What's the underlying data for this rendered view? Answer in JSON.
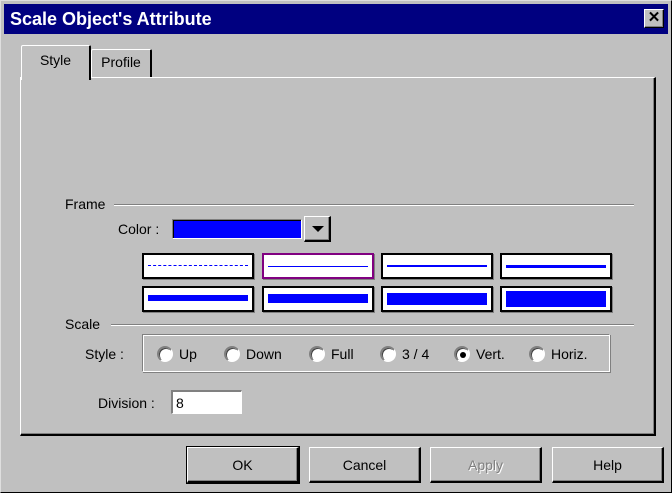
{
  "window": {
    "title": "Scale Object's Attribute",
    "close_label": "✕"
  },
  "tabs": [
    {
      "label": "Style",
      "active": true
    },
    {
      "label": "Profile",
      "active": false
    }
  ],
  "frame": {
    "group_label": "Frame",
    "color_label": "Color :",
    "color_value": "#0000ff",
    "options": [
      {
        "id": 1,
        "selected": false
      },
      {
        "id": 2,
        "selected": true
      },
      {
        "id": 3,
        "selected": false
      },
      {
        "id": 4,
        "selected": false
      },
      {
        "id": 5,
        "selected": false
      },
      {
        "id": 6,
        "selected": false
      },
      {
        "id": 7,
        "selected": false
      },
      {
        "id": 8,
        "selected": false
      }
    ]
  },
  "scale": {
    "group_label": "Scale",
    "style_label": "Style :",
    "style_options": [
      "Up",
      "Down",
      "Full",
      "3 / 4",
      "Vert.",
      "Horiz."
    ],
    "style_selected": "Vert.",
    "division_label": "Division :",
    "division_value": "8"
  },
  "buttons": {
    "ok": "OK",
    "cancel": "Cancel",
    "apply": "Apply",
    "help": "Help"
  },
  "colors": {
    "title_bar": "#000080",
    "face": "#c0c0c0",
    "accent_blue": "#0000ff",
    "selected_border": "#800080"
  }
}
